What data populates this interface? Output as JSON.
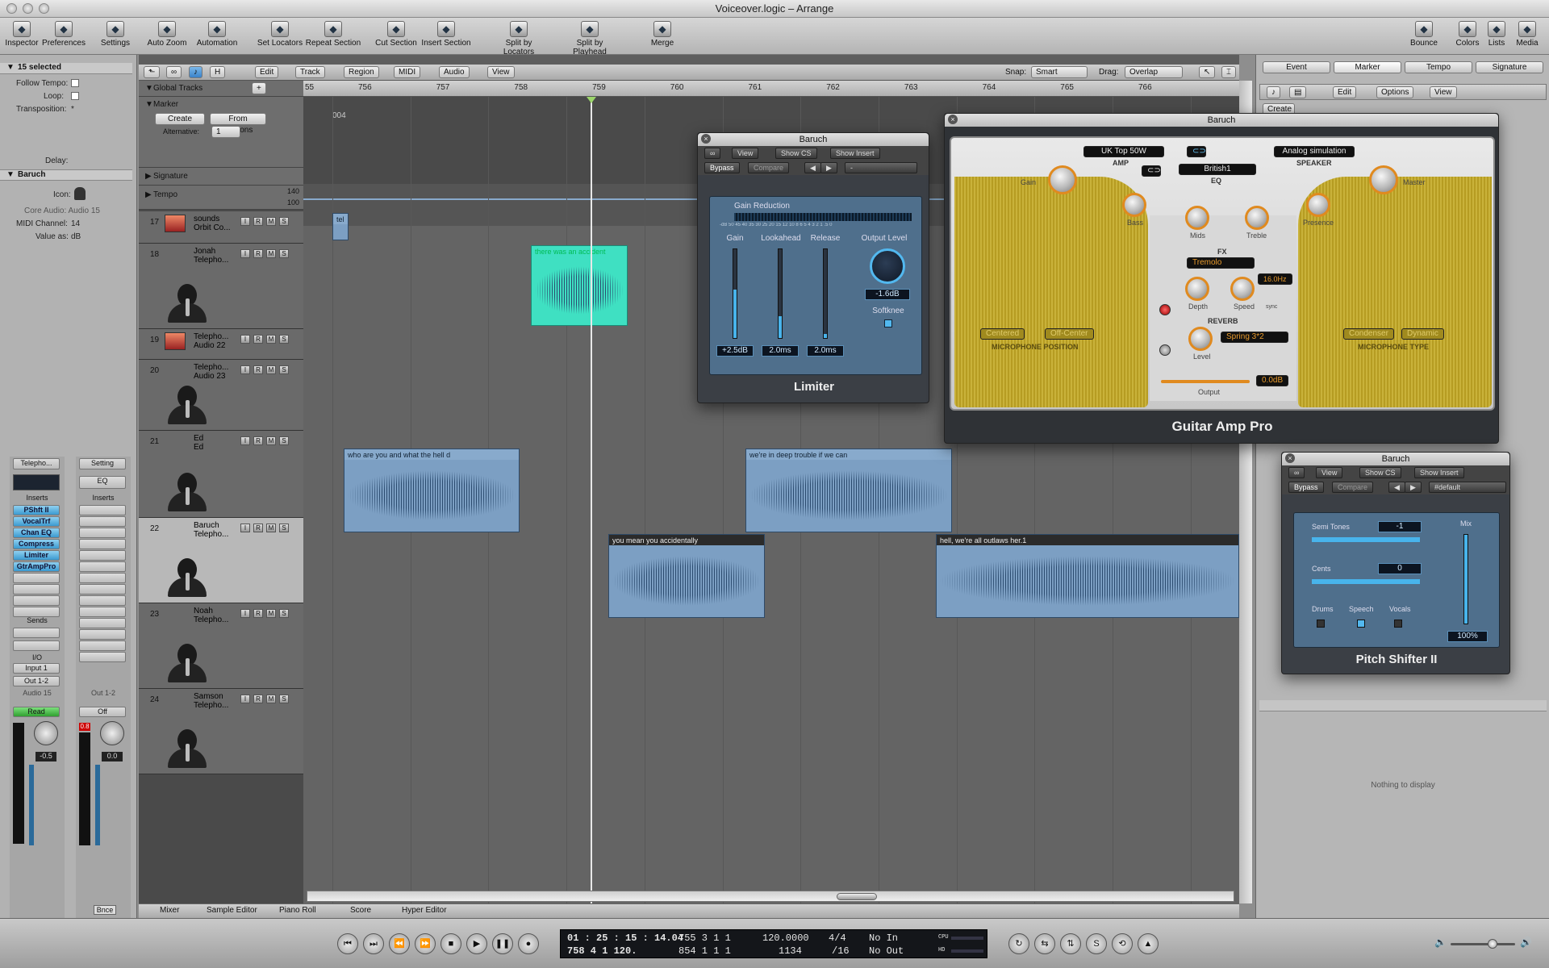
{
  "window": {
    "title": "Voiceover.logic – Arrange"
  },
  "toolbar": {
    "items": [
      {
        "label": "Inspector",
        "icon": "info-icon"
      },
      {
        "label": "Preferences",
        "icon": "preferences-icon"
      },
      {
        "label": "Settings",
        "icon": "settings-icon"
      },
      {
        "label": "Auto Zoom",
        "icon": "auto-zoom-icon"
      },
      {
        "label": "Automation",
        "icon": "automation-icon"
      },
      {
        "label": "Set Locators",
        "icon": "set-locators-icon"
      },
      {
        "label": "Repeat Section",
        "icon": "repeat-section-icon"
      },
      {
        "label": "Cut Section",
        "icon": "cut-section-icon"
      },
      {
        "label": "Insert Section",
        "icon": "insert-section-icon"
      },
      {
        "label": "Split by Locators",
        "icon": "split-locators-icon"
      },
      {
        "label": "Split by Playhead",
        "icon": "split-playhead-icon"
      },
      {
        "label": "Merge",
        "icon": "merge-icon"
      },
      {
        "label": "Bounce",
        "icon": "bounce-icon"
      },
      {
        "label": "Colors",
        "icon": "colors-icon"
      },
      {
        "label": "Lists",
        "icon": "lists-icon"
      },
      {
        "label": "Media",
        "icon": "media-icon"
      }
    ]
  },
  "inspector": {
    "selected": "15 selected",
    "follow_tempo": "Follow Tempo:",
    "loop": "Loop:",
    "transposition": "Transposition:",
    "transposition_value": "*",
    "delay": "Delay:",
    "track_name": "Baruch",
    "icon_label": "Icon:",
    "core_audio": "Core Audio: Audio 15",
    "midi_channel": "MIDI Channel:",
    "midi_channel_value": "14",
    "value_as": "Value as:",
    "value_as_value": "dB",
    "strip1": {
      "name": "Telepho...",
      "inserts_label": "Inserts",
      "inserts": [
        "PShft II",
        "VocalTrf",
        "Chan EQ",
        "Compress",
        "Limiter",
        "GtrAmpPro"
      ],
      "sends": "Sends",
      "io": "I/O",
      "input": "Input 1",
      "output": "Out 1-2",
      "channel": "Audio 15",
      "mode": "Read",
      "volume": "-0.5"
    },
    "strip2": {
      "name": "Setting",
      "eq": "EQ",
      "inserts_label": "Inserts",
      "channel": "Out 1-2",
      "mode": "Off",
      "peak": "0.8",
      "volume": "0.0",
      "bounce": "Bnce"
    }
  },
  "localbar": {
    "menus": [
      "Edit",
      "Track",
      "Region",
      "MIDI",
      "Audio",
      "View"
    ],
    "snap_label": "Snap:",
    "snap_value": "Smart",
    "drag_label": "Drag:",
    "drag_value": "Overlap"
  },
  "global_tracks": {
    "label": "Global Tracks",
    "marker": "Marker",
    "create": "Create",
    "from_regions": "From Regions",
    "alternative_label": "Alternative:",
    "alternative_value": "1",
    "signature": "Signature",
    "tempo": "Tempo",
    "tempo_hi": "140",
    "tempo_lo": "100",
    "marker_name": "004"
  },
  "ruler": {
    "bars": [
      "55",
      "756",
      "757",
      "758",
      "759",
      "760",
      "761",
      "762",
      "763",
      "764",
      "765",
      "766"
    ]
  },
  "tracks": [
    {
      "num": "17",
      "name": "sounds",
      "sub": "Orbit Co..."
    },
    {
      "num": "18",
      "name": "Jonah",
      "sub": "Telepho..."
    },
    {
      "num": "19",
      "name": "Telepho...",
      "sub": "Audio 22"
    },
    {
      "num": "20",
      "name": "Telepho...",
      "sub": "Audio 23"
    },
    {
      "num": "21",
      "name": "Ed",
      "sub": "Ed"
    },
    {
      "num": "22",
      "name": "Baruch",
      "sub": "Telepho..."
    },
    {
      "num": "23",
      "name": "Noah",
      "sub": "Telepho..."
    },
    {
      "num": "24",
      "name": "Samson",
      "sub": "Telepho..."
    }
  ],
  "track_buttons": [
    "I",
    "R",
    "M",
    "S"
  ],
  "regions": [
    {
      "label": "tel"
    },
    {
      "label": "there was an accident"
    },
    {
      "label": "who are you and what the hell d"
    },
    {
      "label": "we're in deep trouble if we can"
    },
    {
      "label": "you mean you accidentally"
    },
    {
      "label": "hell, we're all outlaws her.1"
    }
  ],
  "bottom_tabs": [
    "Mixer",
    "Sample Editor",
    "Piano Roll",
    "Score",
    "Hyper Editor"
  ],
  "transport": {
    "time": "01 : 25 : 15 : 14.04",
    "pos": "755   3   1     1",
    "tempo": "120.0000",
    "sig": "4/4",
    "in": "No In",
    "time2": "758   4   1  120.",
    "pos2": "854   1   1     1",
    "tempo2": "1134",
    "div": "/16",
    "out": "No Out",
    "cpu": "CPU",
    "hd": "HD"
  },
  "list_panel": {
    "tabs": [
      "Event",
      "Marker",
      "Tempo",
      "Signature"
    ],
    "edit": "Edit",
    "options": "Options",
    "view": "View",
    "create": "Create",
    "empty": "Nothing to display"
  },
  "limiter": {
    "title": "Baruch",
    "view": "View",
    "show_cs": "Show CS",
    "show_insert": "Show Insert",
    "bypass": "Bypass",
    "compare": "Compare",
    "preset": "-",
    "gain_reduction": "Gain Reduction",
    "scale": "-dB  50 45 40 35 30 25 20 15 12 10 8  6  5  4  3  2  1  .5  0",
    "gain": "Gain",
    "lookahead": "Lookahead",
    "release": "Release",
    "output_level": "Output Level",
    "gain_val": "+2.5dB",
    "lookahead_val": "2.0ms",
    "release_val": "2.0ms",
    "output_val": "-1.6dB",
    "softknee": "Softknee",
    "name": "Limiter",
    "gain_level": 0.55,
    "lookahead_level": 0.25,
    "release_level": 0.05
  },
  "amp": {
    "title": "Baruch",
    "amp_model": "UK Top 50W",
    "amp_label": "AMP",
    "speaker_model": "Analog simulation",
    "speaker_label": "SPEAKER",
    "eq_model": "British1",
    "eq_label": "EQ",
    "knobs": [
      "Gain",
      "Bass",
      "Mids",
      "Treble",
      "Presence",
      "Master"
    ],
    "fx_label": "FX",
    "fx_model": "Tremolo",
    "depth": "Depth",
    "speed": "Speed",
    "speed_val": "16.0Hz",
    "sync": "sync",
    "reverb_label": "REVERB",
    "reverb_model": "Spring 3*2",
    "level": "Level",
    "mic_pos": [
      "Centered",
      "Off-Center"
    ],
    "mic_pos_label": "MICROPHONE POSITION",
    "mic_type": [
      "Condenser",
      "Dynamic"
    ],
    "mic_type_label": "MICROPHONE TYPE",
    "output": "Output",
    "output_val": "0.0dB",
    "name": "Guitar Amp Pro"
  },
  "pitch": {
    "title": "Baruch",
    "view": "View",
    "show_cs": "Show CS",
    "show_insert": "Show Insert",
    "bypass": "Bypass",
    "compare": "Compare",
    "preset": "#default",
    "semi": "Semi Tones",
    "semi_val": "-1",
    "cents": "Cents",
    "cents_val": "0",
    "drums": "Drums",
    "speech": "Speech",
    "vocals": "Vocals",
    "mix": "Mix",
    "mix_val": "100%",
    "name": "Pitch Shifter II",
    "mix_level": 1.0
  }
}
